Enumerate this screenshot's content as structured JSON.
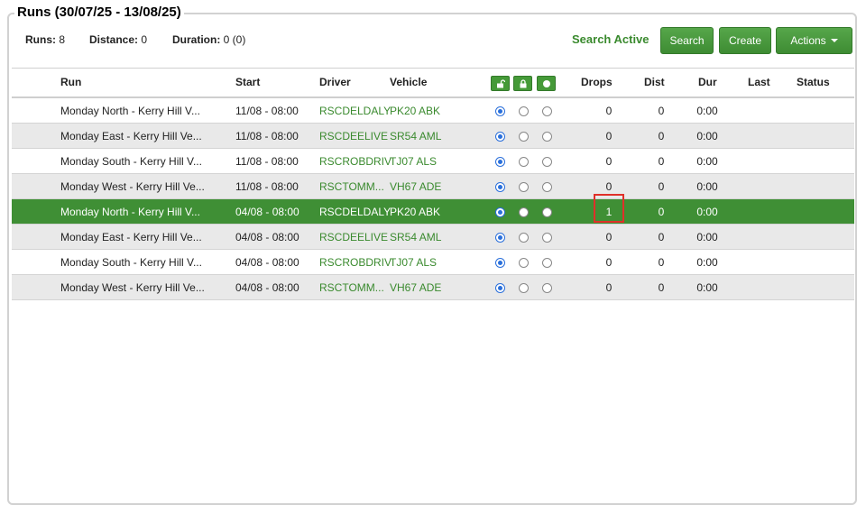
{
  "panel": {
    "title": "Runs (30/07/25 - 13/08/25)",
    "summary": {
      "runs_label": "Runs:",
      "runs_value": "8",
      "distance_label": "Distance:",
      "distance_value": "0",
      "duration_label": "Duration:",
      "duration_value": "0 (0)"
    }
  },
  "toolbar": {
    "search_status": "Search Active",
    "search_label": "Search",
    "create_label": "Create",
    "actions_label": "Actions"
  },
  "table": {
    "headers": {
      "run": "Run",
      "start": "Start",
      "driver": "Driver",
      "vehicle": "Vehicle",
      "drops": "Drops",
      "dist": "Dist",
      "dur": "Dur",
      "last": "Last",
      "status": "Status"
    },
    "header_icons": [
      "unlock-icon",
      "lock-icon",
      "circle-icon"
    ],
    "rows": [
      {
        "run": "Monday North - Kerry Hill V...",
        "start": "11/08 - 08:00",
        "driver": "RSCDELDALY",
        "vehicle": "PK20 ABK",
        "drops": "0",
        "dist": "0",
        "dur": "0:00",
        "last": "",
        "status": "",
        "selected_radio": 0
      },
      {
        "run": "Monday East - Kerry Hill Ve...",
        "start": "11/08 - 08:00",
        "driver": "RSCDEELIVE",
        "vehicle": "SR54 AML",
        "drops": "0",
        "dist": "0",
        "dur": "0:00",
        "last": "",
        "status": "",
        "selected_radio": 0
      },
      {
        "run": "Monday South - Kerry Hill V...",
        "start": "11/08 - 08:00",
        "driver": "RSCROBDRIV",
        "vehicle": "TJ07 ALS",
        "drops": "0",
        "dist": "0",
        "dur": "0:00",
        "last": "",
        "status": "",
        "selected_radio": 0
      },
      {
        "run": "Monday West - Kerry Hill Ve...",
        "start": "11/08 - 08:00",
        "driver": "RSCTOMM...",
        "vehicle": "VH67 ADE",
        "drops": "0",
        "dist": "0",
        "dur": "0:00",
        "last": "",
        "status": "",
        "selected_radio": 0
      },
      {
        "run": "Monday North - Kerry Hill V...",
        "start": "04/08 - 08:00",
        "driver": "RSCDELDALY",
        "vehicle": "PK20 ABK",
        "drops": "1",
        "dist": "0",
        "dur": "0:00",
        "last": "",
        "status": "",
        "selected_radio": 0
      },
      {
        "run": "Monday East - Kerry Hill Ve...",
        "start": "04/08 - 08:00",
        "driver": "RSCDEELIVE",
        "vehicle": "SR54 AML",
        "drops": "0",
        "dist": "0",
        "dur": "0:00",
        "last": "",
        "status": "",
        "selected_radio": 0
      },
      {
        "run": "Monday South - Kerry Hill V...",
        "start": "04/08 - 08:00",
        "driver": "RSCROBDRIV",
        "vehicle": "TJ07 ALS",
        "drops": "0",
        "dist": "0",
        "dur": "0:00",
        "last": "",
        "status": "",
        "selected_radio": 0
      },
      {
        "run": "Monday West - Kerry Hill Ve...",
        "start": "04/08 - 08:00",
        "driver": "RSCTOMM...",
        "vehicle": "VH67 ADE",
        "drops": "0",
        "dist": "0",
        "dur": "0:00",
        "last": "",
        "status": "",
        "selected_radio": 0
      }
    ],
    "selected_row_index": 4,
    "highlighted_cell": "drops",
    "colors": {
      "accent": "#3f8f35",
      "link_green": "#3a8a2e",
      "row_alt": "#e9e9e9",
      "highlight_border": "#e0302a",
      "radio_blue": "#2a6fdb"
    }
  }
}
